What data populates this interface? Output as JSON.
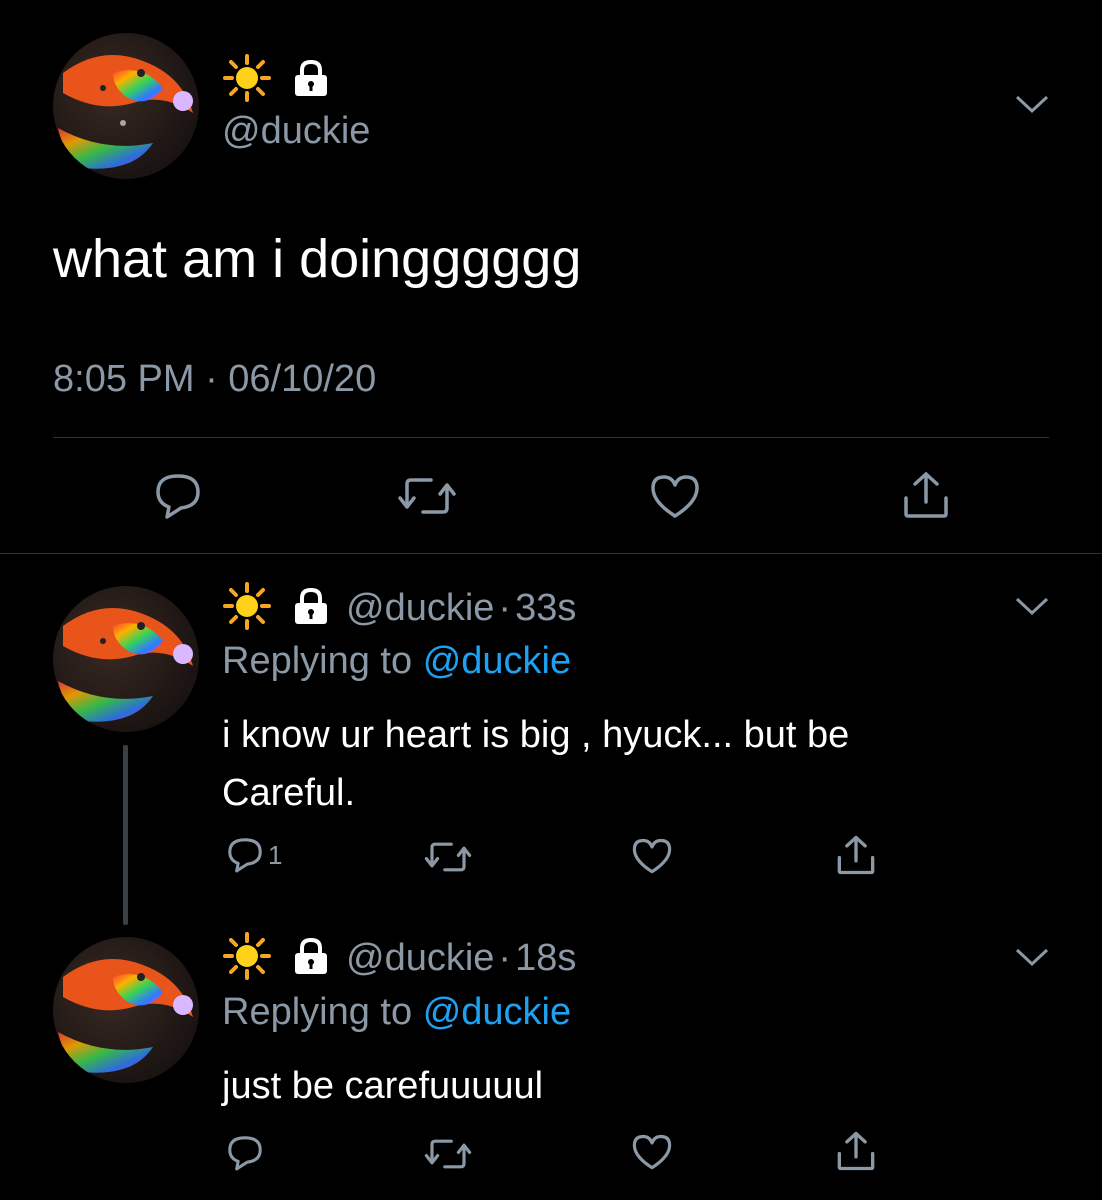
{
  "main_tweet": {
    "display_name_icon": "sun-emoji",
    "lock_icon": "lock-icon",
    "handle": "@duckie",
    "text": "what am i doingggggg",
    "timestamp": "8:05 PM · 06/10/20"
  },
  "replies": [
    {
      "handle": "@duckie",
      "time": "33s",
      "replying_label": "Replying to",
      "replying_to": "@duckie",
      "text_line1": "i know ur heart is big , hyuck... but be",
      "text_line2": "Careful.",
      "reply_count": "1"
    },
    {
      "handle": "@duckie",
      "time": "18s",
      "replying_label": "Replying to",
      "replying_to": "@duckie",
      "text_line1": "just be carefuuuuul",
      "reply_count": ""
    }
  ],
  "separator": "·",
  "colors": {
    "background": "#000000",
    "text": "#ffffff",
    "secondary": "#8b98a5",
    "link": "#1da1f2",
    "divider": "#2f3336"
  }
}
